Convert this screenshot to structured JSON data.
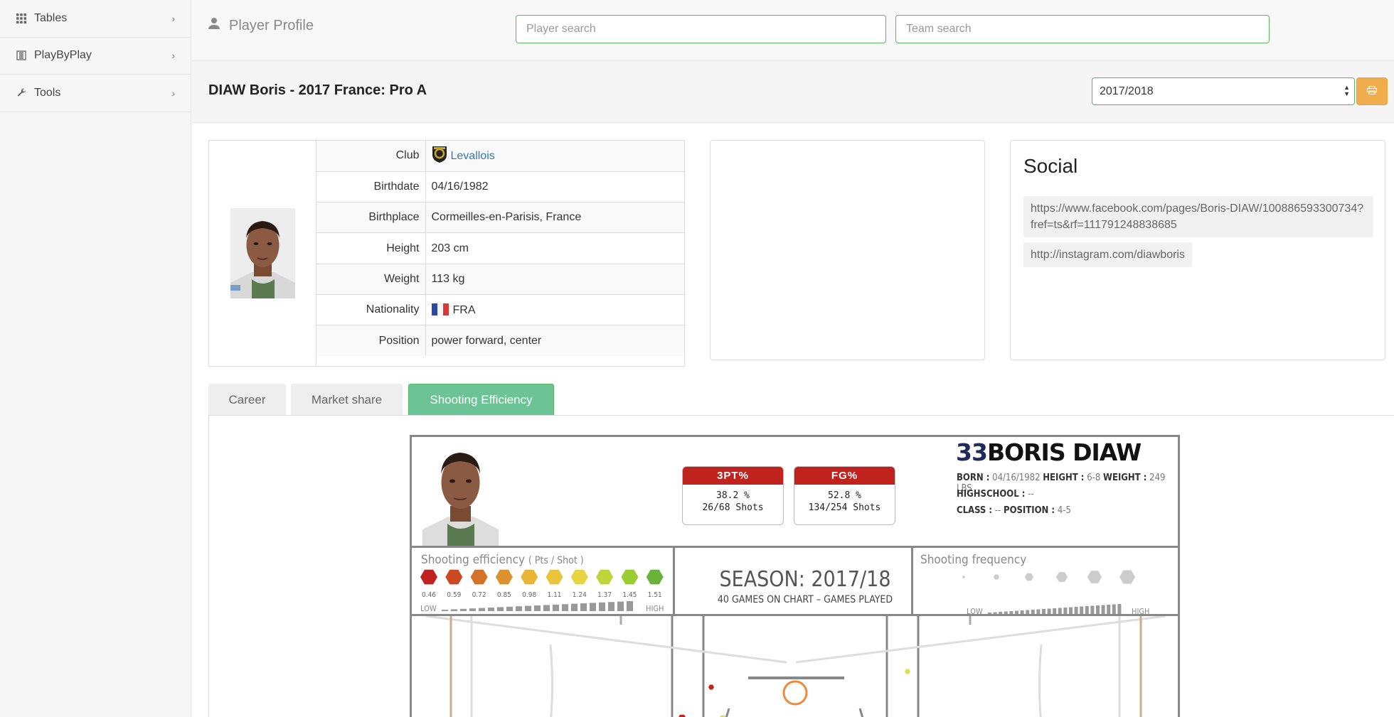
{
  "sidebar": {
    "items": [
      {
        "label": "Tables",
        "icon": "grid-icon"
      },
      {
        "label": "PlayByPlay",
        "icon": "film-icon"
      },
      {
        "label": "Tools",
        "icon": "wrench-icon"
      }
    ]
  },
  "header": {
    "title": "Player Profile",
    "player_search_placeholder": "Player search",
    "team_search_placeholder": "Team search"
  },
  "page": {
    "title": "DIAW Boris - 2017 France: Pro A",
    "season_selected": "2017/2018"
  },
  "info": {
    "rows": [
      {
        "key": "Club",
        "value": "Levallois"
      },
      {
        "key": "Birthdate",
        "value": "04/16/1982"
      },
      {
        "key": "Birthplace",
        "value": "Cormeilles-en-Parisis, France"
      },
      {
        "key": "Height",
        "value": "203 cm"
      },
      {
        "key": "Weight",
        "value": "113 kg"
      },
      {
        "key": "Nationality",
        "value": "FRA"
      },
      {
        "key": "Position",
        "value": "power forward, center"
      }
    ]
  },
  "social": {
    "title": "Social",
    "links": [
      "https://www.facebook.com/pages/Boris-DIAW/100886593300734?fref=ts&rf=111791248838685",
      "http://instagram.com/diawboris"
    ]
  },
  "tabs": [
    "Career",
    "Market share",
    "Shooting Efficiency"
  ],
  "active_tab": "Shooting Efficiency",
  "shot_chart": {
    "number": "33",
    "name": "BORIS DIAW",
    "bio": {
      "born_label": "BORN :",
      "born": "04/16/1982",
      "height_label": "HEIGHT :",
      "height": "6-8",
      "weight_label": "WEIGHT :",
      "weight": "249 LBS",
      "highschool_label": "HIGHSCHOOL :",
      "highschool": "--",
      "class_label": "CLASS :",
      "class": "--",
      "position_label": "POSITION :",
      "position": "4-5"
    },
    "three_pt": {
      "label": "3PT%",
      "pct": "38.2 %",
      "shots": "26/68  Shots"
    },
    "fg": {
      "label": "FG%",
      "pct": "52.8 %",
      "shots": "134/254  Shots"
    },
    "efficiency_title": "Shooting efficiency",
    "efficiency_sub": "( Pts / Shot )",
    "efficiency_scale": [
      "0.46",
      "0.59",
      "0.72",
      "0.85",
      "0.98",
      "1.11",
      "1.24",
      "1.37",
      "1.45",
      "1.51"
    ],
    "efficiency_colors": [
      "#c0231e",
      "#cc4a22",
      "#d4722a",
      "#dc922e",
      "#e8b535",
      "#eac43a",
      "#e6d440",
      "#bfd43a",
      "#9acd32",
      "#6ab33a"
    ],
    "low_label": "LOW",
    "high_label": "HIGH",
    "season": "SEASON: 2017/18",
    "games": "40 GAMES ON CHART – GAMES PLAYED",
    "frequency_title": "Shooting frequency"
  }
}
